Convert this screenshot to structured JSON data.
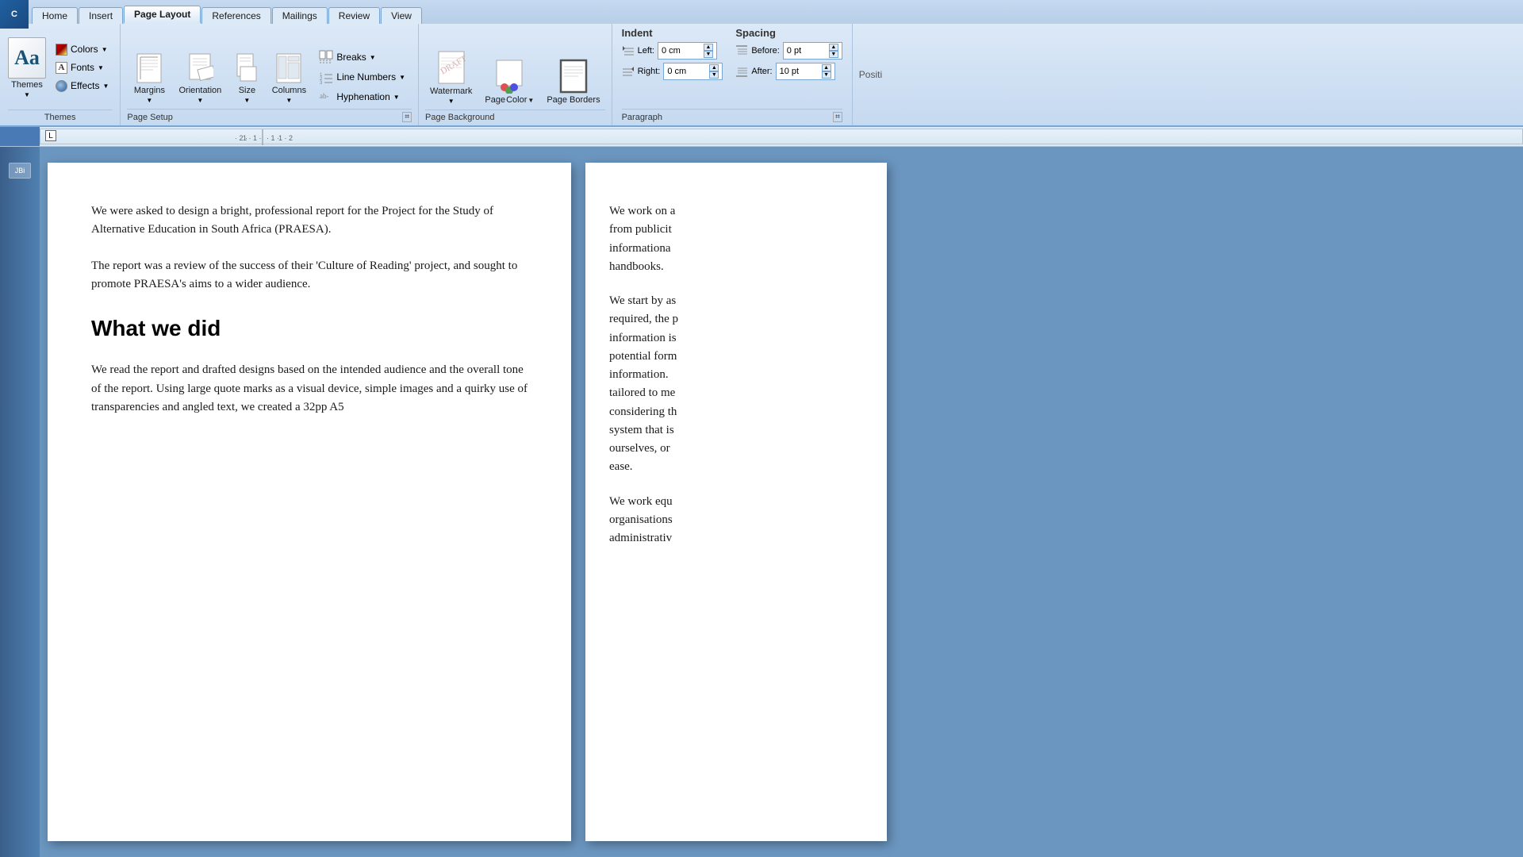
{
  "ribbon": {
    "tabs": [
      "Home",
      "Insert",
      "Page Layout",
      "References",
      "Mailings",
      "Review",
      "View"
    ],
    "active_tab": "Page Layout",
    "groups": {
      "themes": {
        "label": "Themes",
        "themes_btn_label": "Themes",
        "colors_label": "Colors",
        "fonts_label": "Fonts",
        "effects_label": "Effects"
      },
      "page_setup": {
        "label": "Page Setup",
        "buttons": [
          "Margins",
          "Orientation",
          "Size",
          "Columns"
        ],
        "breaks_label": "Breaks",
        "line_numbers_label": "Line Numbers",
        "hyphenation_label": "Hyphenation",
        "dialog_launcher": "⌗"
      },
      "page_background": {
        "label": "Page Background",
        "watermark_label": "Watermark",
        "page_color_label": "Page Color",
        "page_borders_label": "Page Borders"
      },
      "paragraph": {
        "label": "Paragraph",
        "indent": {
          "title": "Indent",
          "left_label": "Left:",
          "left_value": "0 cm",
          "right_label": "Right:",
          "right_value": "0 cm"
        },
        "spacing": {
          "title": "Spacing",
          "before_label": "Before:",
          "before_value": "0 pt",
          "after_label": "After:",
          "after_value": "10 pt"
        },
        "dialog_launcher": "⌗"
      },
      "position": {
        "label": "Positi"
      }
    }
  },
  "document": {
    "page1": {
      "paragraphs": [
        "We were asked to design a bright, professional report for the Project for the Study of Alternative Education in South Africa (PRAESA).",
        "The report was a review of the success of their ‘Culture of Reading’ project, and sought to promote PRAESA’s aims to a wider audience.",
        "What we did",
        "We read the report and drafted designs based on the intended audience and the overall tone of the report. Using large quote marks as a visual device, simple images and a quirky use of transparencies and angled text, we created a 32pp A5"
      ],
      "heading": "What we did"
    },
    "page2": {
      "paragraphs": [
        "We work on a from publicit informationa handbooks.",
        "We start by as required, the p information is potential form information. tailored to me considering th system that is ourselves, or ease.",
        "We work equ organisations administrativ"
      ]
    }
  },
  "ruler": {
    "tab_marker": "L"
  },
  "sidebar": {
    "label": "JBi"
  }
}
